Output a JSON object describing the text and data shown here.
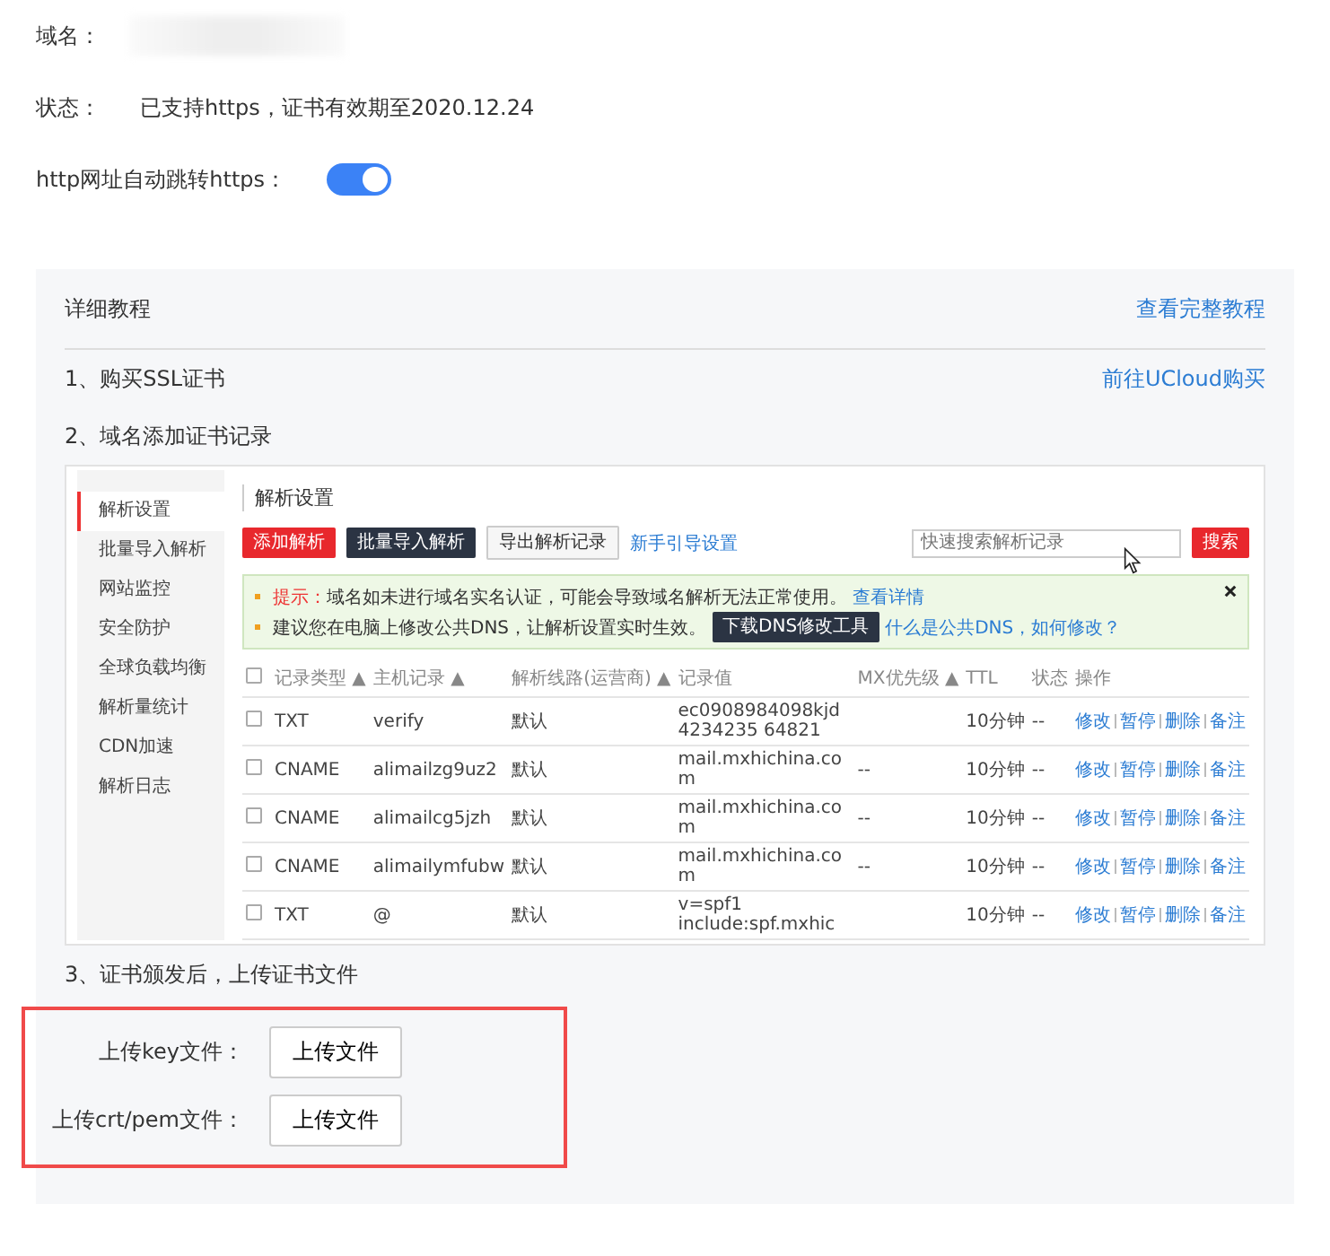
{
  "domain": {
    "label": "域名："
  },
  "status": {
    "label": "状态：",
    "value": "已支持https，证书有效期至2020.12.24"
  },
  "https_redirect": {
    "label": "http网址自动跳转https：",
    "on": true
  },
  "tutorial": {
    "title": "详细教程",
    "link": "查看完整教程",
    "steps": [
      {
        "text": "1、购买SSL证书",
        "link": "前往UCloud购买"
      },
      {
        "text": "2、域名添加证书记录"
      },
      {
        "text": "3、证书颁发后，上传证书文件"
      }
    ]
  },
  "screenshot": {
    "sidebar": [
      {
        "label": "解析设置",
        "selected": true
      },
      {
        "label": "批量导入解析",
        "selected": false
      },
      {
        "label": "网站监控",
        "selected": false
      },
      {
        "label": "安全防护",
        "selected": false
      },
      {
        "label": "全球负载均衡",
        "selected": false
      },
      {
        "label": "解析量统计",
        "selected": false
      },
      {
        "label": "CDN加速",
        "selected": false
      },
      {
        "label": "解析日志",
        "selected": false
      }
    ],
    "title": "解析设置",
    "actions": [
      {
        "kind": "primary",
        "label": "添加解析"
      },
      {
        "kind": "dark",
        "label": "批量导入解析"
      },
      {
        "kind": "plain",
        "label": "导出解析记录"
      },
      {
        "kind": "link",
        "label": "新手引导设置"
      }
    ],
    "search": {
      "placeholder": "快速搜索解析记录",
      "button": "搜索"
    },
    "notice": {
      "tip_label": "提示：",
      "tip_text": "域名如未进行域名实名认证，可能会导致域名解析无法正常使用。",
      "tip_link": "查看详情",
      "dns_text": "建议您在电脑上修改公共DNS，让解析设置实时生效。",
      "dns_button": "下载DNS修改工具",
      "dns_link": "什么是公共DNS，如何修改？"
    },
    "select_all_checked": false,
    "columns": [
      "记录类型 ▲",
      "主机记录 ▲",
      "解析线路(运营商) ▲",
      "记录值",
      "MX优先级 ▲",
      "TTL",
      "状态",
      "操作"
    ],
    "rows": [
      {
        "checked": false,
        "cells": [
          "TXT",
          "verify",
          "默认",
          "ec0908984098kjd4234235 64821",
          "",
          "10分钟",
          "--"
        ],
        "actions": [
          "修改",
          "暂停",
          "删除",
          "备注"
        ]
      },
      {
        "checked": false,
        "cells": [
          "CNAME",
          "alimailzg9uz2",
          "默认",
          "mail.mxhichina.com",
          "--",
          "10分钟",
          "--"
        ],
        "actions": [
          "修改",
          "暂停",
          "删除",
          "备注"
        ]
      },
      {
        "checked": false,
        "cells": [
          "CNAME",
          "alimailcg5jzh",
          "默认",
          "mail.mxhichina.com",
          "--",
          "10分钟",
          "--"
        ],
        "actions": [
          "修改",
          "暂停",
          "删除",
          "备注"
        ]
      },
      {
        "checked": false,
        "cells": [
          "CNAME",
          "alimailymfubw",
          "默认",
          "mail.mxhichina.com",
          "--",
          "10分钟",
          "--"
        ],
        "actions": [
          "修改",
          "暂停",
          "删除",
          "备注"
        ]
      },
      {
        "checked": false,
        "cells": [
          "TXT",
          "@",
          "默认",
          "v=spf1 include:spf.mxhic",
          "",
          "10分钟",
          "--"
        ],
        "actions": [
          "修改",
          "暂停",
          "删除",
          "备注"
        ]
      }
    ]
  },
  "uploads": [
    {
      "label": "上传key文件：",
      "button": "上传文件"
    },
    {
      "label": "上传crt/pem文件：",
      "button": "上传文件"
    }
  ]
}
